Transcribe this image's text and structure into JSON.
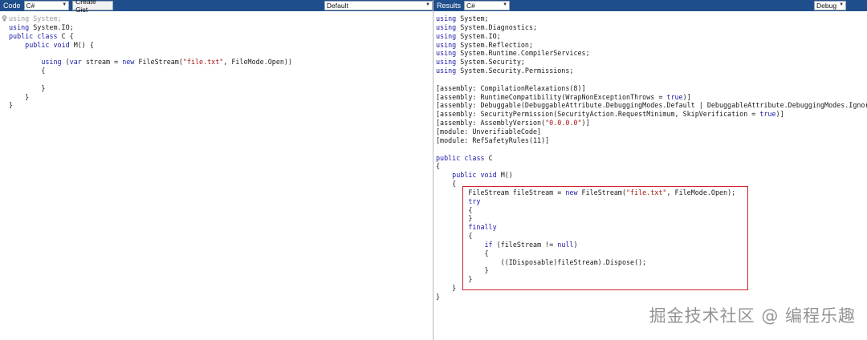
{
  "left_toolbar": {
    "code_label": "Code",
    "language_select": "C#",
    "create_gist_label": "Create Gist",
    "branch_select": "Default"
  },
  "right_toolbar": {
    "results_label": "Results",
    "language_select": "C#",
    "mode_select": "Debug"
  },
  "source_code": [
    [
      {
        "t": "using System;",
        "c": "dim"
      }
    ],
    [
      {
        "t": "using",
        "c": "kw"
      },
      {
        "t": " System.IO;"
      }
    ],
    [
      {
        "t": "public",
        "c": "kw"
      },
      {
        "t": " "
      },
      {
        "t": "class",
        "c": "kw"
      },
      {
        "t": " C {"
      }
    ],
    [
      {
        "t": "    "
      },
      {
        "t": "public",
        "c": "kw"
      },
      {
        "t": " "
      },
      {
        "t": "void",
        "c": "kw"
      },
      {
        "t": " M() {"
      }
    ],
    [
      {
        "t": ""
      }
    ],
    [
      {
        "t": "        "
      },
      {
        "t": "using",
        "c": "kw"
      },
      {
        "t": " ("
      },
      {
        "t": "var",
        "c": "kw"
      },
      {
        "t": " stream = "
      },
      {
        "t": "new",
        "c": "kw"
      },
      {
        "t": " FileStream("
      },
      {
        "t": "\"file.txt\"",
        "c": "str"
      },
      {
        "t": ", FileMode.Open))"
      }
    ],
    [
      {
        "t": "        {"
      }
    ],
    [
      {
        "t": ""
      }
    ],
    [
      {
        "t": "        }"
      }
    ],
    [
      {
        "t": "    }"
      }
    ],
    [
      {
        "t": "}"
      }
    ]
  ],
  "result_code": [
    [
      {
        "t": "using",
        "c": "kw"
      },
      {
        "t": " System;"
      }
    ],
    [
      {
        "t": "using",
        "c": "kw"
      },
      {
        "t": " System.Diagnostics;"
      }
    ],
    [
      {
        "t": "using",
        "c": "kw"
      },
      {
        "t": " System.IO;"
      }
    ],
    [
      {
        "t": "using",
        "c": "kw"
      },
      {
        "t": " System.Reflection;"
      }
    ],
    [
      {
        "t": "using",
        "c": "kw"
      },
      {
        "t": " System.Runtime.CompilerServices;"
      }
    ],
    [
      {
        "t": "using",
        "c": "kw"
      },
      {
        "t": " System.Security;"
      }
    ],
    [
      {
        "t": "using",
        "c": "kw"
      },
      {
        "t": " System.Security.Permissions;"
      }
    ],
    [
      {
        "t": ""
      }
    ],
    [
      {
        "t": "[assembly: CompilationRelaxations(8)]"
      }
    ],
    [
      {
        "t": "[assembly: RuntimeCompatibility(WrapNonExceptionThrows = "
      },
      {
        "t": "true",
        "c": "kw"
      },
      {
        "t": ")]"
      }
    ],
    [
      {
        "t": "[assembly: Debuggable(DebuggableAttribute.DebuggingModes.Default | DebuggableAttribute.DebuggingModes.IgnoreS"
      }
    ],
    [
      {
        "t": "[assembly: SecurityPermission(SecurityAction.RequestMinimum, SkipVerification = "
      },
      {
        "t": "true",
        "c": "kw"
      },
      {
        "t": ")]"
      }
    ],
    [
      {
        "t": "[assembly: AssemblyVersion("
      },
      {
        "t": "\"0.0.0.0\"",
        "c": "str"
      },
      {
        "t": ")]"
      }
    ],
    [
      {
        "t": "[module: UnverifiableCode]"
      }
    ],
    [
      {
        "t": "[module: RefSafetyRules(11)]"
      }
    ],
    [
      {
        "t": ""
      }
    ],
    [
      {
        "t": "public",
        "c": "kw"
      },
      {
        "t": " "
      },
      {
        "t": "class",
        "c": "kw"
      },
      {
        "t": " C"
      }
    ],
    [
      {
        "t": "{"
      }
    ],
    [
      {
        "t": "    "
      },
      {
        "t": "public",
        "c": "kw"
      },
      {
        "t": " "
      },
      {
        "t": "void",
        "c": "kw"
      },
      {
        "t": " M()"
      }
    ],
    [
      {
        "t": "    {"
      }
    ],
    [
      {
        "t": "        FileStream fileStream = "
      },
      {
        "t": "new",
        "c": "kw"
      },
      {
        "t": " FileStream("
      },
      {
        "t": "\"file.txt\"",
        "c": "str"
      },
      {
        "t": ", FileMode.Open);"
      }
    ],
    [
      {
        "t": "        "
      },
      {
        "t": "try",
        "c": "kw"
      }
    ],
    [
      {
        "t": "        {"
      }
    ],
    [
      {
        "t": "        }"
      }
    ],
    [
      {
        "t": "        "
      },
      {
        "t": "finally",
        "c": "kw"
      }
    ],
    [
      {
        "t": "        {"
      }
    ],
    [
      {
        "t": "            "
      },
      {
        "t": "if",
        "c": "kw"
      },
      {
        "t": " (fileStream != "
      },
      {
        "t": "null",
        "c": "kw"
      },
      {
        "t": ")"
      }
    ],
    [
      {
        "t": "            {"
      }
    ],
    [
      {
        "t": "                ((IDisposable)fileStream).Dispose();"
      }
    ],
    [
      {
        "t": "            }"
      }
    ],
    [
      {
        "t": "        }"
      }
    ],
    [
      {
        "t": "    }"
      }
    ],
    [
      {
        "t": "}"
      }
    ]
  ],
  "watermark": "掘金技术社区 @ 编程乐趣",
  "colors": {
    "toolbar": "#1f4e8c",
    "keyword": "#1a1aa6",
    "string": "#a31515",
    "highlight_border": "#d0202a"
  }
}
